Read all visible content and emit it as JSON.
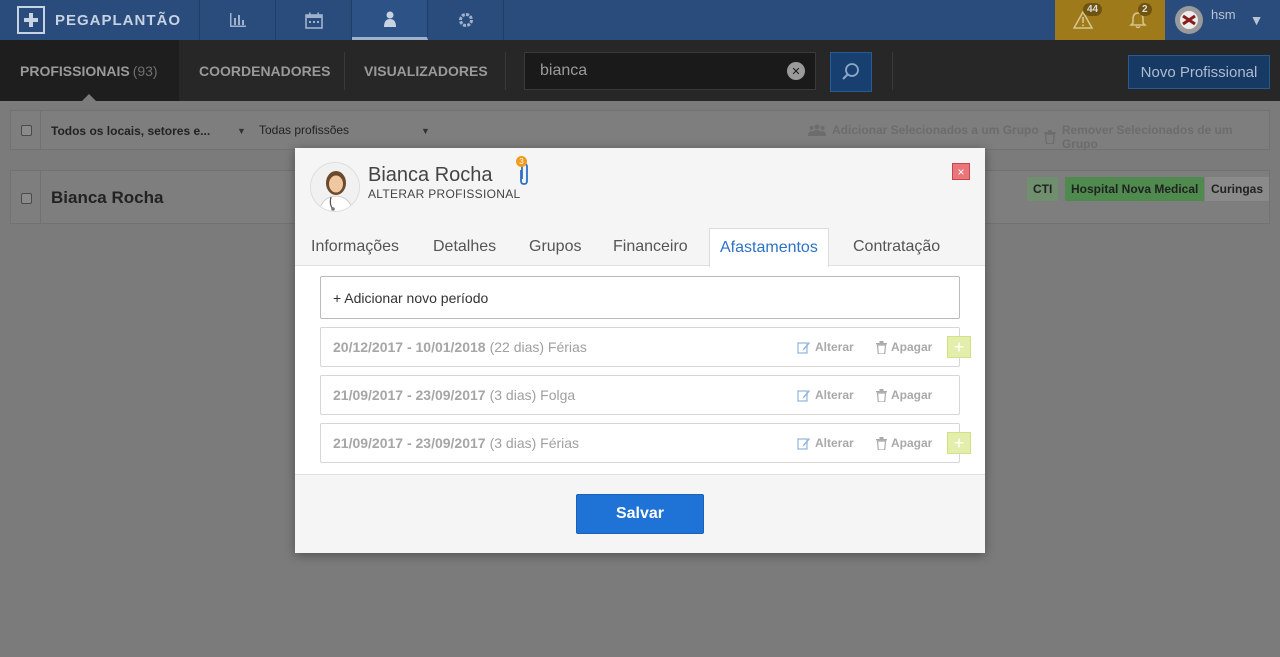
{
  "app": {
    "logo_text": "PEGAPLANTÃO"
  },
  "topnav": {
    "icons": [
      "bar-chart-icon",
      "calendar-icon",
      "user-icon",
      "gear-icon"
    ],
    "alerts": [
      {
        "icon": "warning-icon",
        "count": "44"
      },
      {
        "icon": "bell-icon",
        "count": "2"
      }
    ],
    "user": {
      "name": "hsm"
    }
  },
  "subnav": {
    "tabs": [
      {
        "label": "PROFISSIONAIS",
        "count": "(93)"
      },
      {
        "label": "COORDENADORES"
      },
      {
        "label": "VISUALIZADORES"
      }
    ],
    "search_value": "bianca",
    "new_button": "Novo Profissional"
  },
  "filters": {
    "location": "Todos os locais, setores e...",
    "profession": "Todas profissões",
    "add_selected": "Adicionar Selecionados a um Grupo",
    "remove_selected": "Remover Selecionados de um Grupo"
  },
  "list": {
    "rows": [
      {
        "name": "Bianca Rocha",
        "tags": [
          "CTI",
          "Hospital Nova Medical",
          "Curingas"
        ]
      }
    ]
  },
  "modal": {
    "name": "Bianca Rocha",
    "subtitle": "ALTERAR PROFISSIONAL",
    "attachment_count": "3",
    "close": "×",
    "tabs": [
      "Informações",
      "Detalhes",
      "Grupos",
      "Financeiro",
      "Afastamentos",
      "Contratação"
    ],
    "active_tab": "Afastamentos",
    "add_period": "+ Adicionar novo período",
    "periods": [
      {
        "dates": "20/12/2017 - 10/01/2018",
        "rest": "(22 dias) Férias"
      },
      {
        "dates": "21/09/2017 - 23/09/2017",
        "rest": "(3 dias) Folga"
      },
      {
        "dates": "21/09/2017 - 23/09/2017",
        "rest": "(3 dias) Férias"
      }
    ],
    "edit_label": "Alterar",
    "delete_label": "Apagar",
    "plus": "+",
    "save": "Salvar"
  },
  "colors": {
    "topbar": "#294c7d",
    "accent_blue": "#1f73d6",
    "tab_active": "#2c72c7",
    "alert_bg": "#9e7a1b",
    "tag_green": "#4f8a4f"
  }
}
